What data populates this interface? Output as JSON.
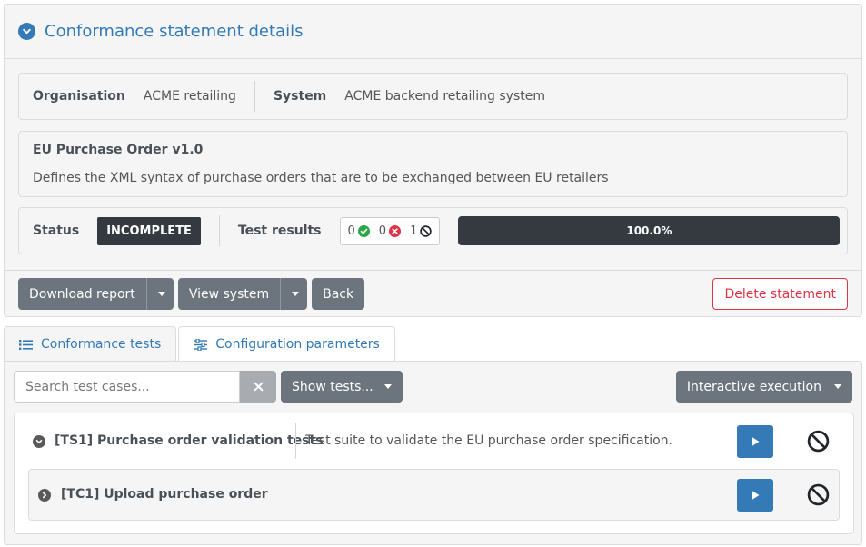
{
  "panel": {
    "title": "Conformance statement details"
  },
  "info": {
    "organisation_label": "Organisation",
    "organisation_value": "ACME retailing",
    "system_label": "System",
    "system_value": "ACME backend retailing system"
  },
  "spec": {
    "name": "EU Purchase Order v1.0",
    "description": "Defines the XML syntax of purchase orders that are to be exchanged between EU retailers"
  },
  "status": {
    "label": "Status",
    "value": "INCOMPLETE",
    "results_label": "Test results",
    "passed": "0",
    "failed": "0",
    "undefined": "1",
    "progress_text": "100.0%",
    "progress_fraction": 1.0
  },
  "toolbar": {
    "download_label": "Download report",
    "view_system_label": "View system",
    "back_label": "Back",
    "delete_label": "Delete statement"
  },
  "tabs": [
    {
      "label": "Conformance tests"
    },
    {
      "label": "Configuration parameters"
    }
  ],
  "filters": {
    "search_placeholder": "Search test cases...",
    "show_tests_label": "Show tests...",
    "interactive_label": "Interactive execution"
  },
  "suite": {
    "title": "[TS1] Purchase order validation tests",
    "description": "Test suite to validate the EU purchase order specification.",
    "test_cases": [
      {
        "title": "[TC1] Upload purchase order"
      }
    ]
  },
  "colors": {
    "accent": "#337ab7",
    "dark": "#343a40",
    "secondary": "#6c757d",
    "danger": "#dc3545",
    "success": "#28a745"
  }
}
